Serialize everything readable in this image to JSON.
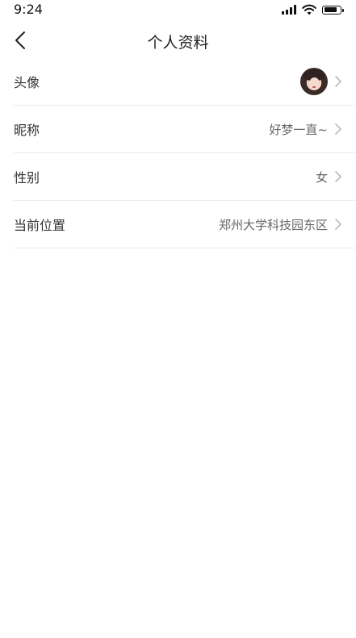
{
  "status_bar": {
    "time": "9:24"
  },
  "nav": {
    "title": "个人资料"
  },
  "rows": [
    {
      "label": "头像",
      "value": ""
    },
    {
      "label": "昵称",
      "value": "好梦一直~"
    },
    {
      "label": "性别",
      "value": "女"
    },
    {
      "label": "当前位置",
      "value": "郑州大学科技园东区"
    }
  ],
  "colors": {
    "divider": "#ececec",
    "label": "#333333",
    "value": "#666666",
    "chevron": "#bbbbbb"
  }
}
